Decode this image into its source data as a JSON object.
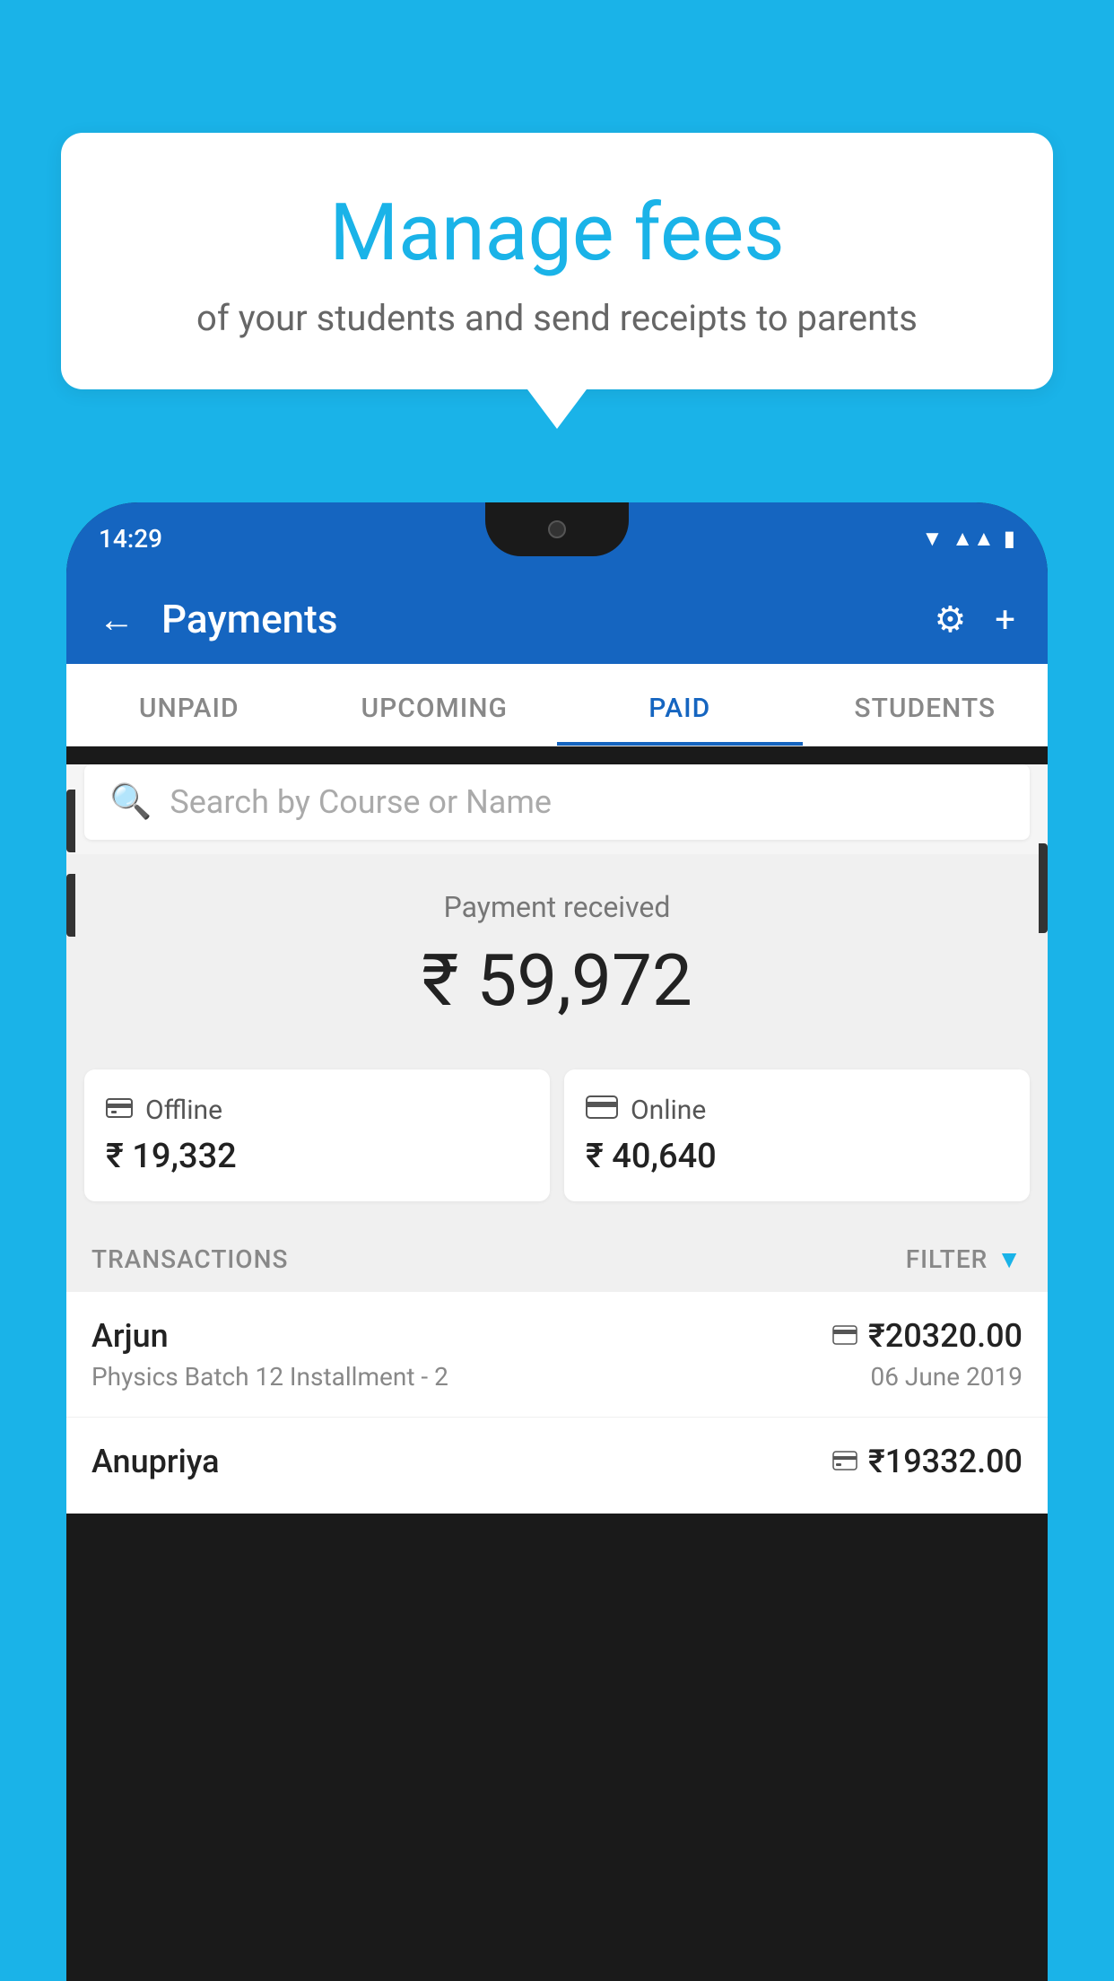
{
  "background_color": "#1ab3e8",
  "speech_bubble": {
    "title": "Manage fees",
    "subtitle": "of your students and send receipts to parents"
  },
  "phone": {
    "status_bar": {
      "time": "14:29"
    },
    "app_header": {
      "title": "Payments",
      "back_label": "←",
      "settings_label": "⚙",
      "add_label": "+"
    },
    "tabs": [
      {
        "label": "UNPAID",
        "active": false
      },
      {
        "label": "UPCOMING",
        "active": false
      },
      {
        "label": "PAID",
        "active": true
      },
      {
        "label": "STUDENTS",
        "active": false
      }
    ],
    "search": {
      "placeholder": "Search by Course or Name"
    },
    "payment_summary": {
      "label": "Payment received",
      "amount": "₹ 59,972",
      "offline": {
        "type": "Offline",
        "amount": "₹ 19,332"
      },
      "online": {
        "type": "Online",
        "amount": "₹ 40,640"
      }
    },
    "transactions": {
      "header_label": "TRANSACTIONS",
      "filter_label": "FILTER",
      "rows": [
        {
          "name": "Arjun",
          "amount": "₹20320.00",
          "course": "Physics Batch 12 Installment - 2",
          "date": "06 June 2019",
          "payment_type": "online"
        },
        {
          "name": "Anupriya",
          "amount": "₹19332.00",
          "course": "",
          "date": "",
          "payment_type": "offline"
        }
      ]
    }
  }
}
